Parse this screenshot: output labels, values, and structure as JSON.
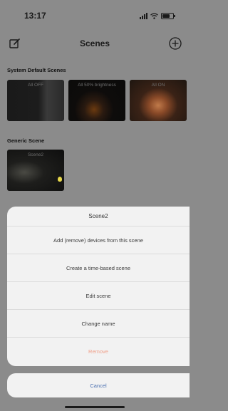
{
  "status_bar": {
    "time": "13:17",
    "signal_icon": "signal-icon",
    "wifi_icon": "wifi-icon",
    "battery_icon": "battery-icon"
  },
  "nav": {
    "title": "Scenes",
    "edit_icon": "edit-icon",
    "add_icon": "add-circle-icon"
  },
  "system_scenes": {
    "title": "System Default Scenes",
    "items": [
      {
        "label": "All OFF"
      },
      {
        "label": "All 50% brightness"
      },
      {
        "label": "All ON"
      }
    ]
  },
  "generic_scenes": {
    "title": "Generic Scene",
    "items": [
      {
        "label": "Scene2",
        "badge_icon": "bulb-icon",
        "badge_color": "#e8d84a"
      }
    ]
  },
  "action_sheet": {
    "title": "Scene2",
    "items": [
      {
        "label": "Add (remove) devices from this scene"
      },
      {
        "label": "Create a time-based scene"
      },
      {
        "label": "Edit scene"
      },
      {
        "label": "Change name"
      },
      {
        "label": "Remove"
      }
    ],
    "cancel_label": "Cancel",
    "remove_color": "#f0a08a",
    "cancel_color": "#4a6fb0"
  }
}
